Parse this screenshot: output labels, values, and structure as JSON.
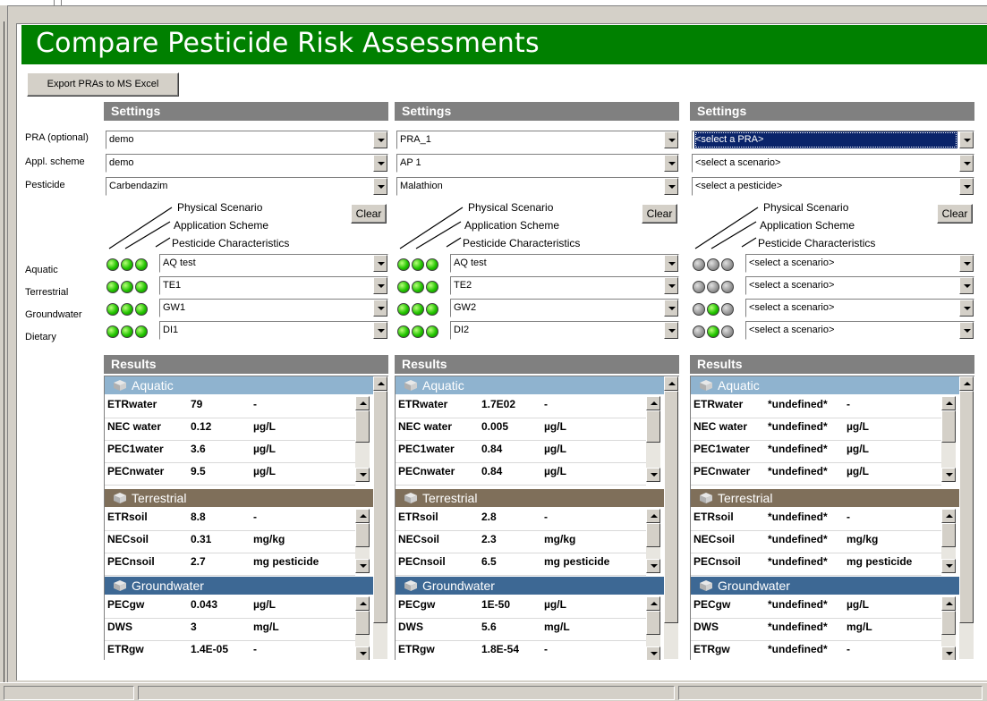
{
  "window": {
    "title": "Compare Pesticide Risk Assessments"
  },
  "toolbar": {
    "export_label": "Export PRAs to MS Excel"
  },
  "row_labels": {
    "pra": "PRA (optional)",
    "appl": "Appl. scheme",
    "pesticide": "Pesticide",
    "aquatic": "Aquatic",
    "terrestrial": "Terrestrial",
    "groundwater": "Groundwater",
    "dietary": "Dietary"
  },
  "legend": {
    "line1": "Physical Scenario",
    "line2": "Application Scheme",
    "line3": "Pesticide Characteristics",
    "clear_label": "Clear"
  },
  "colors": {
    "banner": "#008000",
    "header_gray": "#808080",
    "aquatic": "#8fb3cf",
    "terrestrial": "#7f6f5a",
    "groundwater": "#3d6894",
    "light_on": "#22c400",
    "light_off": "#9a9a9a",
    "selection": "#0a246a"
  },
  "columns": [
    {
      "settings_label": "Settings",
      "pra": "demo",
      "appl": "demo",
      "pesticide": "Carbendazim",
      "pra_selected": false,
      "scenarios": [
        {
          "lights": [
            "on",
            "on",
            "on"
          ],
          "value": "AQ test"
        },
        {
          "lights": [
            "on",
            "on",
            "on"
          ],
          "value": "TE1"
        },
        {
          "lights": [
            "on",
            "on",
            "on"
          ],
          "value": "GW1"
        },
        {
          "lights": [
            "on",
            "on",
            "on"
          ],
          "value": "DI1"
        }
      ],
      "results_label": "Results",
      "aquatic": {
        "title": "Aquatic",
        "rows": [
          {
            "name": "ETRwater",
            "value": "79",
            "unit": "-"
          },
          {
            "name": "NEC water",
            "value": "0.12",
            "unit": "µg/L"
          },
          {
            "name": "PEC1water",
            "value": "3.6",
            "unit": "µg/L"
          },
          {
            "name": "PECnwater",
            "value": "9.5",
            "unit": "µg/L"
          }
        ]
      },
      "terrestrial": {
        "title": "Terrestrial",
        "rows": [
          {
            "name": "ETRsoil",
            "value": "8.8",
            "unit": "-"
          },
          {
            "name": "NECsoil",
            "value": "0.31",
            "unit": "mg/kg"
          },
          {
            "name": "PECnsoil",
            "value": "2.7",
            "unit": "mg pesticide"
          }
        ]
      },
      "groundwater": {
        "title": "Groundwater",
        "rows": [
          {
            "name": "PECgw",
            "value": "0.043",
            "unit": "µg/L"
          },
          {
            "name": "DWS",
            "value": "3",
            "unit": "mg/L"
          },
          {
            "name": "ETRgw",
            "value": "1.4E-05",
            "unit": "-"
          }
        ]
      }
    },
    {
      "settings_label": "Settings",
      "pra": "PRA_1",
      "appl": "AP 1",
      "pesticide": "Malathion",
      "pra_selected": false,
      "scenarios": [
        {
          "lights": [
            "on",
            "on",
            "on"
          ],
          "value": "AQ test"
        },
        {
          "lights": [
            "on",
            "on",
            "on"
          ],
          "value": "TE2"
        },
        {
          "lights": [
            "on",
            "on",
            "on"
          ],
          "value": "GW2"
        },
        {
          "lights": [
            "on",
            "on",
            "on"
          ],
          "value": "DI2"
        }
      ],
      "results_label": "Results",
      "aquatic": {
        "title": "Aquatic",
        "rows": [
          {
            "name": "ETRwater",
            "value": "1.7E02",
            "unit": "-"
          },
          {
            "name": "NEC water",
            "value": "0.005",
            "unit": "µg/L"
          },
          {
            "name": "PEC1water",
            "value": "0.84",
            "unit": "µg/L"
          },
          {
            "name": "PECnwater",
            "value": "0.84",
            "unit": "µg/L"
          }
        ]
      },
      "terrestrial": {
        "title": "Terrestrial",
        "rows": [
          {
            "name": "ETRsoil",
            "value": "2.8",
            "unit": "-"
          },
          {
            "name": "NECsoil",
            "value": "2.3",
            "unit": "mg/kg"
          },
          {
            "name": "PECnsoil",
            "value": "6.5",
            "unit": "mg pesticide"
          }
        ]
      },
      "groundwater": {
        "title": "Groundwater",
        "rows": [
          {
            "name": "PECgw",
            "value": "1E-50",
            "unit": "µg/L"
          },
          {
            "name": "DWS",
            "value": "5.6",
            "unit": "mg/L"
          },
          {
            "name": "ETRgw",
            "value": "1.8E-54",
            "unit": "-"
          }
        ]
      }
    },
    {
      "settings_label": "Settings",
      "pra": "<select a PRA>",
      "appl": "<select a scenario>",
      "pesticide": "<select a pesticide>",
      "pra_selected": true,
      "scenarios": [
        {
          "lights": [
            "off",
            "off",
            "off"
          ],
          "value": "<select a scenario>"
        },
        {
          "lights": [
            "off",
            "off",
            "off"
          ],
          "value": "<select a scenario>"
        },
        {
          "lights": [
            "off",
            "on",
            "off"
          ],
          "value": "<select a scenario>"
        },
        {
          "lights": [
            "off",
            "on",
            "off"
          ],
          "value": "<select a scenario>"
        }
      ],
      "results_label": "Results",
      "aquatic": {
        "title": "Aquatic",
        "rows": [
          {
            "name": "ETRwater",
            "value": "*undefined*",
            "unit": "-"
          },
          {
            "name": "NEC water",
            "value": "*undefined*",
            "unit": "µg/L"
          },
          {
            "name": "PEC1water",
            "value": "*undefined*",
            "unit": "µg/L"
          },
          {
            "name": "PECnwater",
            "value": "*undefined*",
            "unit": "µg/L"
          }
        ]
      },
      "terrestrial": {
        "title": "Terrestrial",
        "rows": [
          {
            "name": "ETRsoil",
            "value": "*undefined*",
            "unit": "-"
          },
          {
            "name": "NECsoil",
            "value": "*undefined*",
            "unit": "mg/kg"
          },
          {
            "name": "PECnsoil",
            "value": "*undefined*",
            "unit": "mg pesticide"
          }
        ]
      },
      "groundwater": {
        "title": "Groundwater",
        "rows": [
          {
            "name": "PECgw",
            "value": "*undefined*",
            "unit": "µg/L"
          },
          {
            "name": "DWS",
            "value": "*undefined*",
            "unit": "mg/L"
          },
          {
            "name": "ETRgw",
            "value": "*undefined*",
            "unit": "-"
          }
        ]
      }
    }
  ]
}
